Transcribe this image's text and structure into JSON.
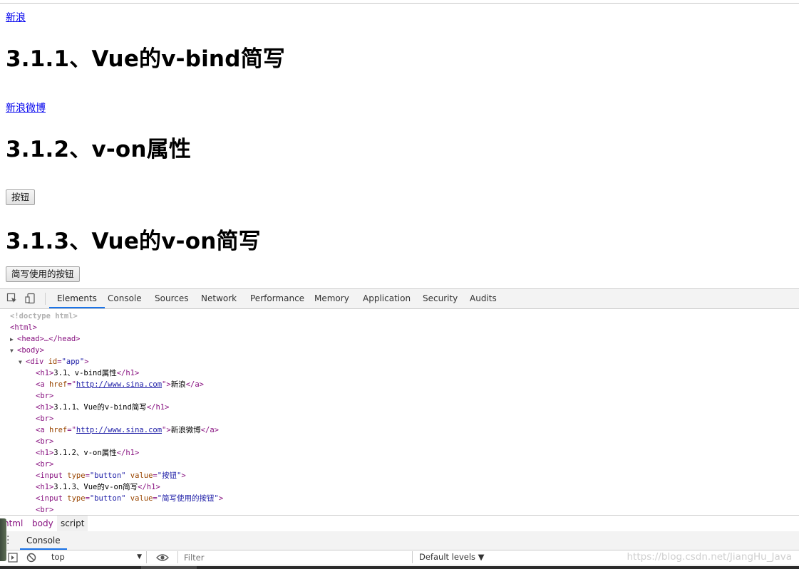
{
  "page": {
    "link1": "新浪",
    "heading1": "3.1.1、Vue的v-bind简写",
    "link2": "新浪微博",
    "heading2": "3.1.2、v-on属性",
    "button1": "按钮",
    "heading3": "3.1.3、Vue的v-on简写",
    "button2": "简写使用的按钮"
  },
  "devtools": {
    "tabs": [
      "Elements",
      "Console",
      "Sources",
      "Network",
      "Performance",
      "Memory",
      "Application",
      "Security",
      "Audits"
    ],
    "active_tab": "Elements",
    "dom": {
      "doctype": "<!doctype html>",
      "html_open": "<html>",
      "head": "<head>…</head>",
      "body_open": "<body>",
      "div": {
        "tag_open": "<div ",
        "attr": "id",
        "val": "\"app\"",
        "close": ">"
      },
      "h1_1": {
        "open": "<h1>",
        "text": "3.1、v-bind属性",
        "close": "</h1>"
      },
      "a1": {
        "open": "<a ",
        "attr": "href",
        "url": "http://www.sina.com",
        "text": "新浪",
        "close": "</a>"
      },
      "br": "<br>",
      "h1_2": {
        "open": "<h1>",
        "text": "3.1.1、Vue的v-bind简写",
        "close": "</h1>"
      },
      "a2": {
        "open": "<a ",
        "attr": "href",
        "url": "http://www.sina.com",
        "text": "新浪微博",
        "close": "</a>"
      },
      "h1_3": {
        "open": "<h1>",
        "text": "3.1.2、v-on属性",
        "close": "</h1>"
      },
      "input1": {
        "open": "<input ",
        "type_attr": "type",
        "type_val": "\"button\"",
        "value_attr": "value",
        "value_val": "\"按钮\"",
        "close": ">"
      },
      "h1_4": {
        "open": "<h1>",
        "text": "3.1.3、Vue的v-on简写",
        "close": "</h1>"
      },
      "input2": {
        "open": "<input ",
        "type_attr": "type",
        "type_val": "\"button\"",
        "value_attr": "value",
        "value_val": "\"简写使用的按钮\"",
        "close": ">"
      }
    },
    "breadcrumbs": [
      "html",
      "body",
      "script"
    ],
    "drawer_tab": "Console",
    "console": {
      "context": "top",
      "filter_placeholder": "Filter",
      "levels": "Default levels ▼"
    },
    "watermark": "https://blog.csdn.net/JiangHu_Java"
  },
  "colors": {
    "link": "#0000ee",
    "active_tab_underline": "#1a73e8",
    "tag": "#881280",
    "attr": "#994500",
    "value": "#1a1aa6"
  }
}
